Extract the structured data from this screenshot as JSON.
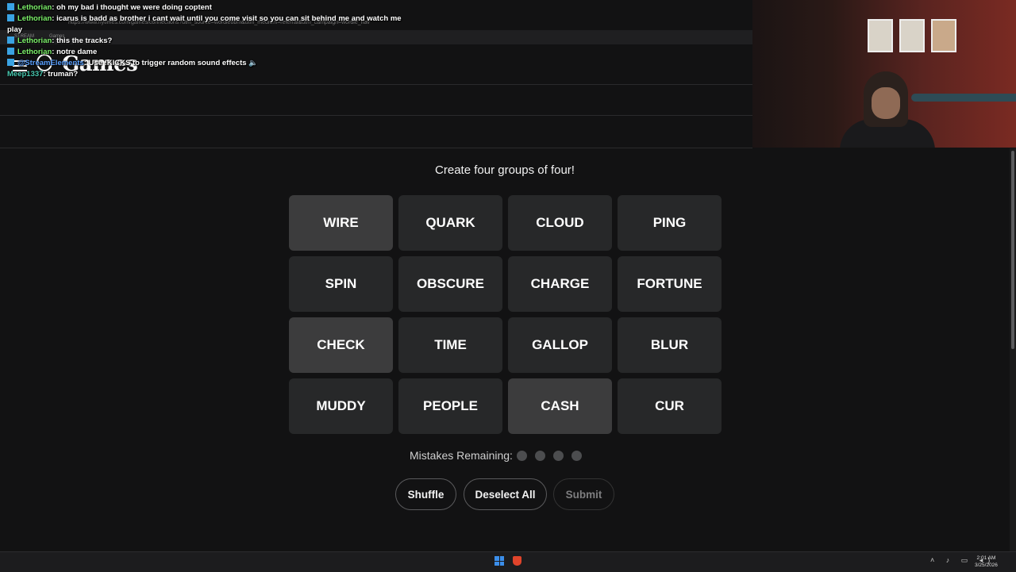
{
  "browser": {
    "url": "https://www.nytimes.com/games/connections?utm_source=wordleobm&utm_medium=referral&utm_campaign=wordle_nav",
    "tabs": [
      "STREAM",
      "Games"
    ],
    "logo_text": "Games"
  },
  "chat": [
    {
      "user": "Lethorian",
      "message": ": oh my bad i thought we were doing coptent",
      "color": "green"
    },
    {
      "user": "Lethorian",
      "message": ": icarus is badd as brother i cant wait until you come visit so you can sit behind me and watch me",
      "color": "green"
    },
    {
      "user": "",
      "message": "play",
      "color": "white"
    },
    {
      "user": "Lethorian",
      "message": ": this the tracks?",
      "color": "green"
    },
    {
      "user": "Lethorian",
      "message": ": notre dame",
      "color": "green"
    },
    {
      "user": "@StreamElements",
      "message": ": Use !KICKS to trigger random sound effects 🔈",
      "color": "blue"
    },
    {
      "user": "Meep1337",
      "message": ": truman?",
      "color": "teal"
    }
  ],
  "game": {
    "instructions": "Create four groups of four!",
    "tiles": [
      {
        "word": "WIRE",
        "selected": true
      },
      {
        "word": "QUARK",
        "selected": false
      },
      {
        "word": "CLOUD",
        "selected": false
      },
      {
        "word": "PING",
        "selected": false
      },
      {
        "word": "SPIN",
        "selected": false
      },
      {
        "word": "OBSCURE",
        "selected": false
      },
      {
        "word": "CHARGE",
        "selected": false
      },
      {
        "word": "FORTUNE",
        "selected": false
      },
      {
        "word": "CHECK",
        "selected": true
      },
      {
        "word": "TIME",
        "selected": false
      },
      {
        "word": "GALLOP",
        "selected": false
      },
      {
        "word": "BLUR",
        "selected": false
      },
      {
        "word": "MUDDY",
        "selected": false
      },
      {
        "word": "PEOPLE",
        "selected": false
      },
      {
        "word": "CASH",
        "selected": true
      },
      {
        "word": "CUR",
        "selected": false
      }
    ],
    "mistakes_label": "Mistakes Remaining:",
    "mistakes_remaining": 4,
    "buttons": {
      "shuffle": "Shuffle",
      "deselect": "Deselect All",
      "submit": "Submit"
    }
  },
  "taskbar": {
    "time": "2:01 AM",
    "date": "3/25/2026"
  },
  "colors": {
    "background": "#121213",
    "tile": "#272829",
    "tile_selected": "#3c3c3d",
    "chat_user": "#7cf06a"
  }
}
